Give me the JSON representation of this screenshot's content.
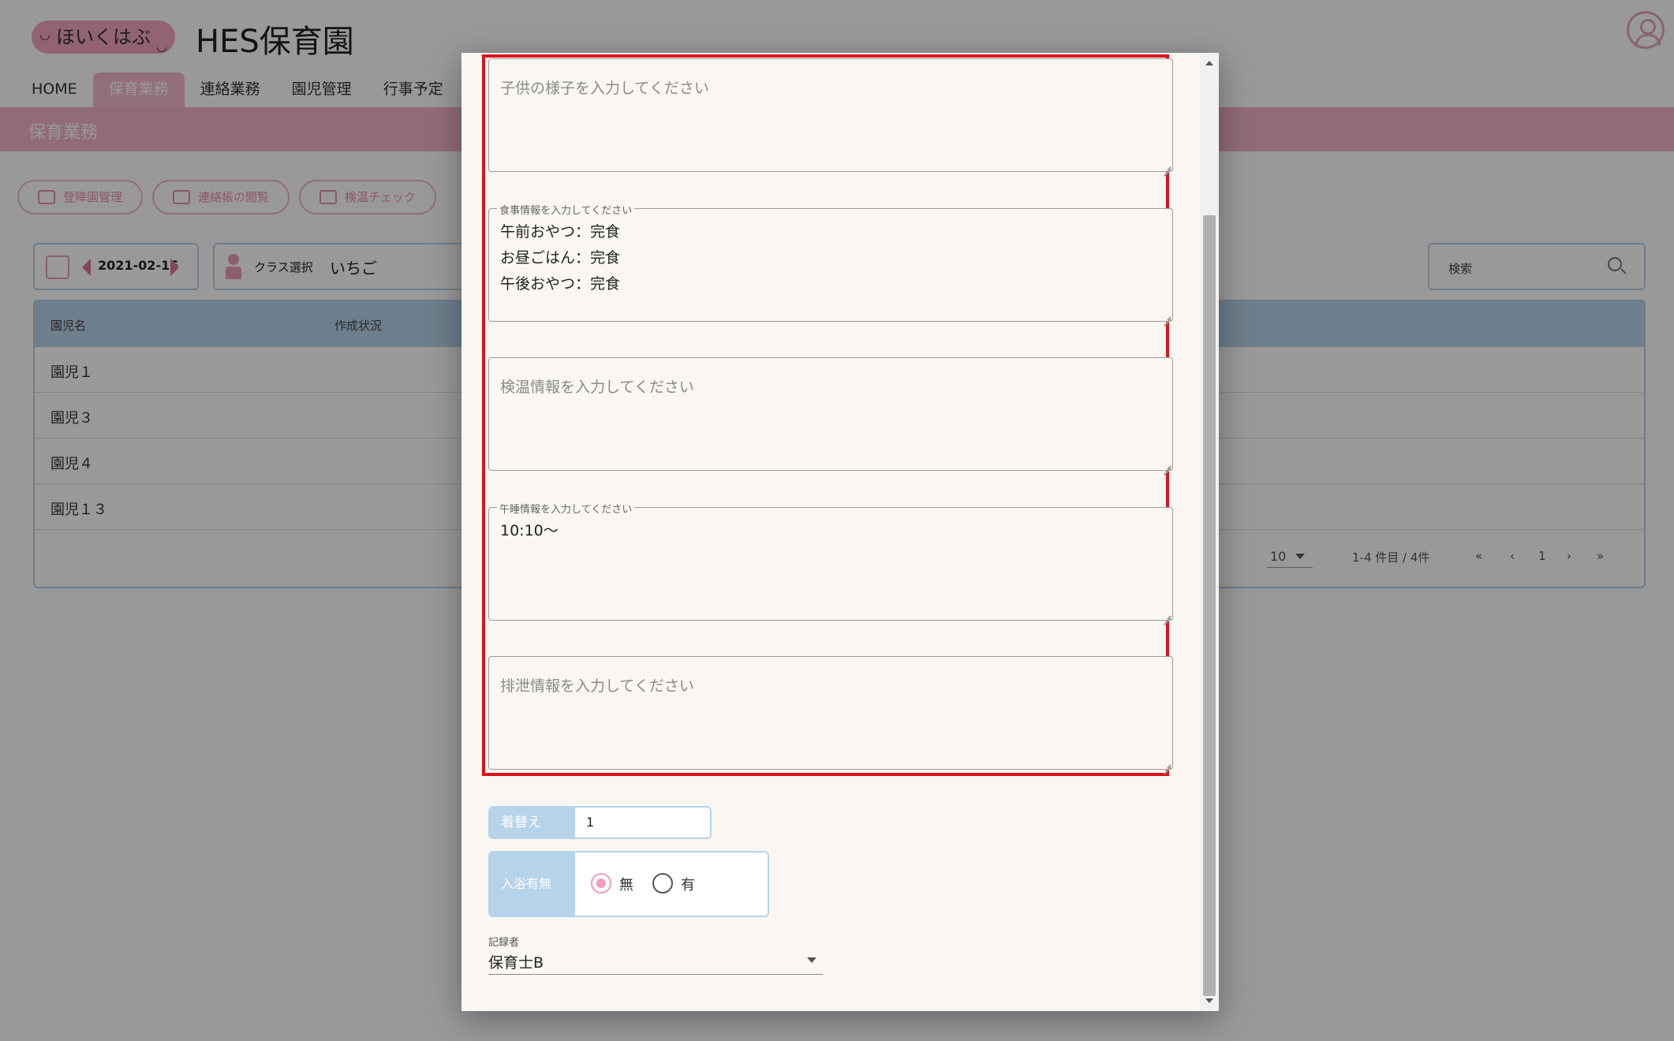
{
  "header": {
    "logo_text": "ほいくはぶ",
    "site_title": "HES保育園"
  },
  "nav": {
    "items": [
      {
        "label": "HOME"
      },
      {
        "label": "保育業務"
      },
      {
        "label": "連絡業務"
      },
      {
        "label": "園児管理"
      },
      {
        "label": "行事予定"
      }
    ],
    "active": "保育業務"
  },
  "section": {
    "title": "保育業務"
  },
  "pills": [
    {
      "label": "登降園管理"
    },
    {
      "label": "連絡帳の閲覧"
    },
    {
      "label": "検温チェック"
    }
  ],
  "toolbar": {
    "date": "2021-02-15",
    "class_label": "クラス選択",
    "class_value": "いちご",
    "search_label": "検索"
  },
  "table": {
    "columns": [
      "園児名",
      "作成状況"
    ],
    "rows": [
      "園児１",
      "園児３",
      "園児４",
      "園児１３"
    ],
    "page_size": "10",
    "range": "1-4 件目 / 4件",
    "page": "1"
  },
  "dialog": {
    "fields": [
      {
        "legend": "",
        "placeholder": "子供の様子を入力してください",
        "value": []
      },
      {
        "legend": "食事情報を入力してください",
        "placeholder": "",
        "value": [
          "午前おやつ：完食",
          "お昼ごはん：完食",
          "午後おやつ：完食"
        ]
      },
      {
        "legend": "",
        "placeholder": "検温情報を入力してください",
        "value": []
      },
      {
        "legend": "午睡情報を入力してください",
        "placeholder": "",
        "value": [
          "10:10～"
        ]
      },
      {
        "legend": "",
        "placeholder": "排泄情報を入力してください",
        "value": []
      }
    ],
    "change": {
      "label": "着替え",
      "value": "1"
    },
    "bath": {
      "label": "入浴有無",
      "options": [
        "無",
        "有"
      ],
      "selected": "無"
    },
    "recorder": {
      "label": "記録者",
      "value": "保育士B"
    }
  },
  "colors": {
    "accent_pink": "#f3b8cd",
    "accent_blue": "#b6d3ea",
    "highlight_red": "#d9141c"
  }
}
